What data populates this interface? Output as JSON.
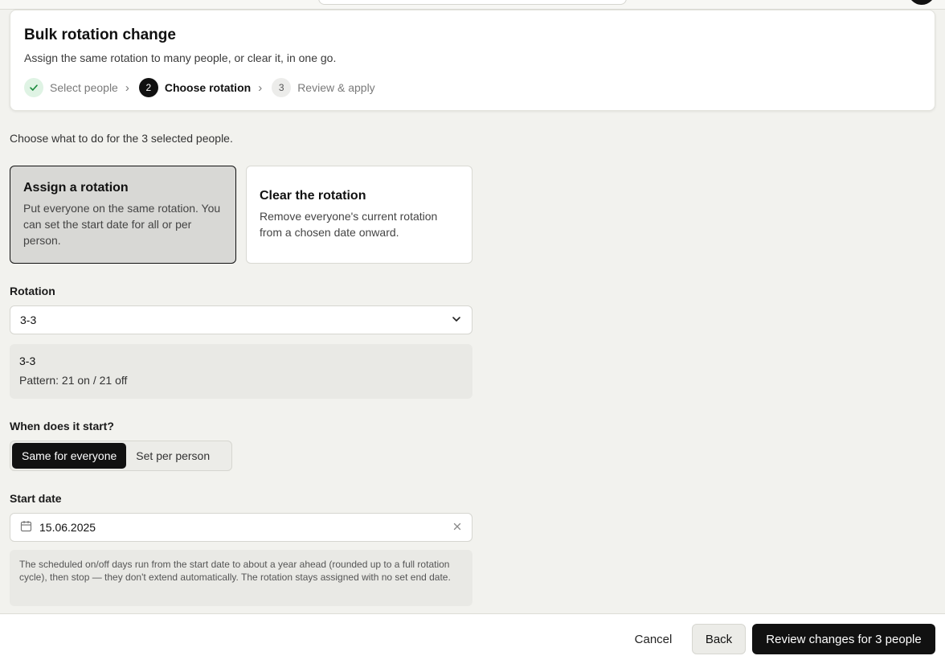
{
  "header": {
    "title": "Bulk rotation change",
    "subtitle": "Assign the same rotation to many people, or clear it, in one go."
  },
  "stepper": {
    "steps": [
      {
        "badge": "✓",
        "label": "Select people",
        "state": "done"
      },
      {
        "badge": "2",
        "label": "Choose rotation",
        "state": "current"
      },
      {
        "badge": "3",
        "label": "Review & apply",
        "state": "pending"
      }
    ]
  },
  "intro": "Choose what to do for the 3 selected people.",
  "modes": {
    "assign": {
      "title": "Assign a rotation",
      "description": "Put everyone on the same rotation. You can set the start date for all or per person.",
      "selected": true
    },
    "clear": {
      "title": "Clear the rotation",
      "description": "Remove everyone's current rotation from a chosen date onward.",
      "selected": false
    }
  },
  "rotation": {
    "label": "Rotation",
    "selected_value": "3-3",
    "info_name": "3-3",
    "info_pattern": "Pattern: 21 on / 21 off"
  },
  "start": {
    "label": "When does it start?",
    "options": [
      "Same for everyone",
      "Set per person"
    ],
    "active_option": "Same for everyone"
  },
  "start_date": {
    "label": "Start date",
    "value": "15.06.2025",
    "icons": {
      "calendar": "calendar-icon",
      "clear": "close-icon"
    }
  },
  "note": "The scheduled on/off days run from the start date to about a year ahead (rounded up to a full rotation cycle), then stop — they don't extend automatically. The rotation stays assigned with no set end date.",
  "footer": {
    "cancel_label": "Cancel",
    "back_label": "Back",
    "primary_label": "Review changes for 3 people"
  },
  "colors": {
    "background": "#f2f2ee",
    "primary": "#111111",
    "done_badge": "#dff3e4",
    "done_check": "#1a8a3c"
  }
}
